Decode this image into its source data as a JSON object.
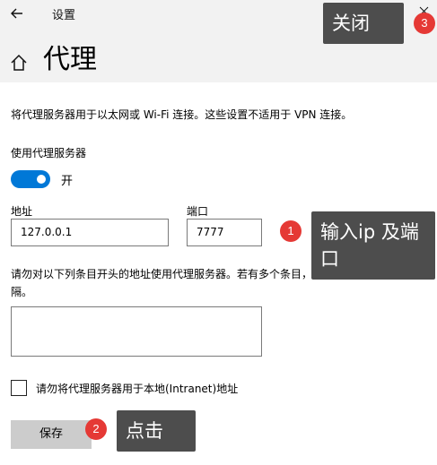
{
  "window": {
    "title": "设置",
    "back_icon": "arrow-left-icon",
    "maximize_icon": "square-icon",
    "close_icon": "close-icon"
  },
  "header": {
    "home_icon": "home-icon",
    "title": "代理"
  },
  "proxy": {
    "description": "将代理服务器用于以太网或 Wi-Fi 连接。这些设置不适用于 VPN 连接。",
    "use_label": "使用代理服务器",
    "toggle_state": "开",
    "toggle_on": true,
    "address_label": "地址",
    "address_value": "127.0.0.1",
    "port_label": "端口",
    "port_value": "7777",
    "exclude_description": "请勿对以下列条目开头的地址使用代理服务器。若有多个条目，请使用英文分号 (;) 来分隔。",
    "exclude_value": "",
    "bypass_local_label": "请勿将代理服务器用于本地(Intranet)地址",
    "bypass_local_checked": false,
    "save_label": "保存"
  },
  "annotations": {
    "step1_number": "1",
    "step1_text": "输入ip 及端口",
    "step2_number": "2",
    "step2_text": "点击",
    "step3_number": "3",
    "step3_text": "关闭"
  },
  "colors": {
    "accent": "#0078d7",
    "badge": "#e53935",
    "callout": "#4d4d4d",
    "titlebar": "#f2f2f2"
  }
}
